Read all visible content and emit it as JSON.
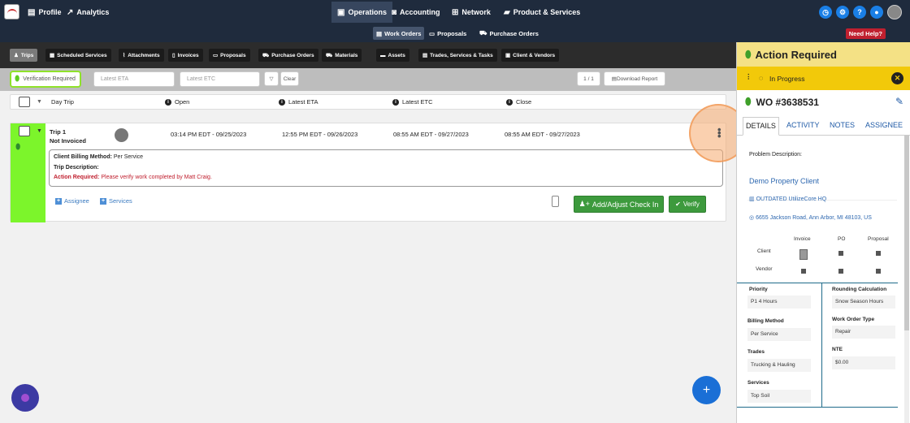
{
  "topnav": {
    "items": [
      {
        "label": "Profile",
        "icon": "document-icon"
      },
      {
        "label": "Analytics",
        "icon": "chart-icon"
      },
      {
        "label": "Operations",
        "icon": "clipboard-icon"
      },
      {
        "label": "Accounting",
        "icon": "money-icon"
      },
      {
        "label": "Network",
        "icon": "network-icon"
      },
      {
        "label": "Product & Services",
        "icon": "briefcase-icon"
      }
    ],
    "active": "Operations"
  },
  "subnav": {
    "items": [
      "Work Orders",
      "Proposals",
      "Purchase Orders"
    ],
    "active": "Work Orders",
    "need_help": "Need Help?"
  },
  "tabs": {
    "items": [
      "Trips",
      "Scheduled Services",
      "Attachments",
      "Invoices",
      "Proposals",
      "Purchase Orders",
      "Materials",
      "Assets",
      "Trades, Services & Tasks",
      "Client & Vendors"
    ],
    "active": "Trips"
  },
  "filters": {
    "status": "Verification Required",
    "eta_placeholder": "Latest ETA",
    "etc_placeholder": "Latest ETC",
    "clear_label": "Clear",
    "pagination": "1 / 1",
    "download_label": "Download Report"
  },
  "table": {
    "headers": [
      "Day Trip",
      "Open",
      "Latest ETA",
      "Latest ETC",
      "Close"
    ]
  },
  "trip": {
    "name": "Trip 1",
    "invoice_status": "Not Invoiced",
    "open": "03:14 PM EDT - 09/25/2023",
    "eta": "12:55 PM EDT - 09/26/2023",
    "etc": "08:55 AM EDT - 09/27/2023",
    "close": "08:55 AM EDT - 09/27/2023",
    "billing_label": "Client Billing Method:",
    "billing_value": "Per Service",
    "trip_desc_label": "Trip Description:",
    "action_label": "Action Required:",
    "action_value": "Please verify work completed by Matt Craig.",
    "assignee_link": "Assignee",
    "services_link": "Services",
    "checkin_label": "Add/Adjust Check In",
    "verify_label": "Verify"
  },
  "panel": {
    "title": "Action Required",
    "status": "In Progress",
    "wo_number": "WO #3638531",
    "tabs": [
      "DETAILS",
      "ACTIVITY",
      "NOTES",
      "ASSIGNEE"
    ],
    "active_tab": "DETAILS",
    "problem_label": "Problem Description:",
    "client_name": "Demo Property Client",
    "location_name": "OUTDATED UtilizeCore HQ",
    "address": "6655 Jackson Road, Ann Arbor, MI 48103, US",
    "grid_cols": [
      "Invoice",
      "PO",
      "Proposal"
    ],
    "grid_rows": [
      "Client",
      "Vendor"
    ],
    "fields_left": [
      {
        "label": "Priority",
        "value": "P1 4 Hours"
      },
      {
        "label": "Billing Method",
        "value": "Per Service"
      },
      {
        "label": "Trades",
        "value": "Trucking & Hauling"
      },
      {
        "label": "Services",
        "value": "Top Soil"
      }
    ],
    "fields_right": [
      {
        "label": "Rounding Calculation",
        "value": "Snow Season Hours"
      },
      {
        "label": "Work Order Type",
        "value": "Repair"
      },
      {
        "label": "NTE",
        "value": "$0.00"
      }
    ]
  },
  "colors": {
    "accent": "#1a7fe6",
    "nav": "#1f2b3d",
    "green": "#7cf52b",
    "yellow": "#f2c90a"
  }
}
